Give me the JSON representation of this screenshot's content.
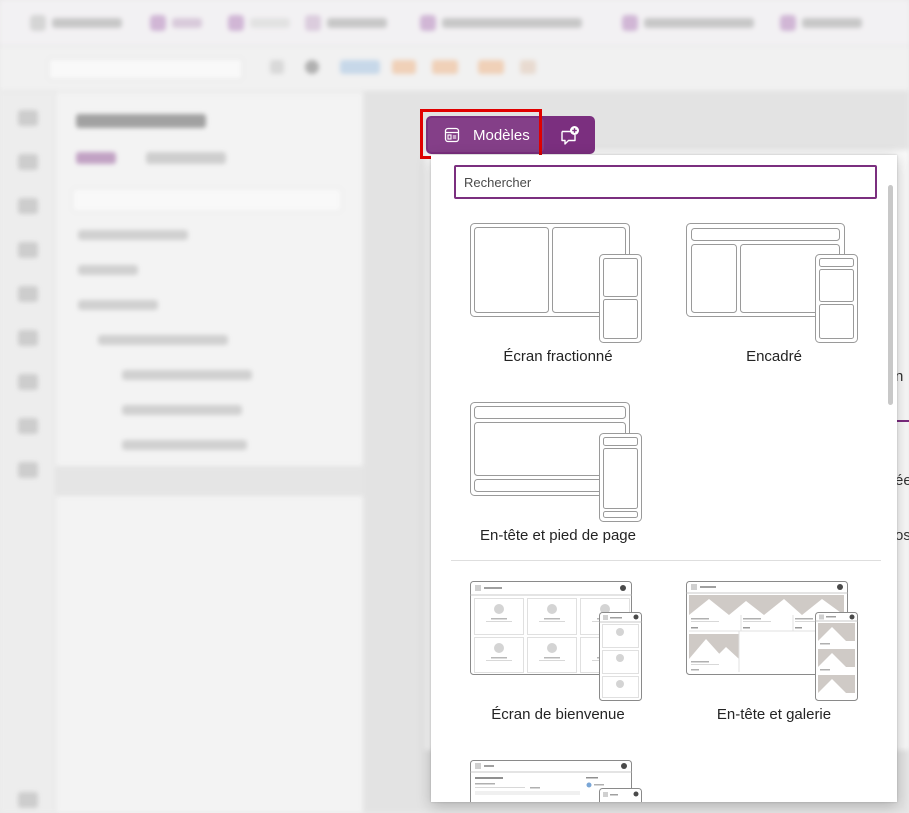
{
  "toolbar": {
    "templates_label": "Modèles",
    "templates_icon": "template-layout-icon",
    "comment_icon": "add-comment-icon"
  },
  "panel": {
    "search_placeholder": "Rechercher",
    "templates": [
      {
        "label": "Écran fractionné",
        "icon": "split-screen-layout"
      },
      {
        "label": "Encadré",
        "icon": "sidebar-layout"
      },
      {
        "label": "En-tête et pied de page",
        "icon": "header-footer-layout"
      },
      {
        "label": "Écran de bienvenue",
        "icon": "welcome-screen-thumbnail"
      },
      {
        "label": "En-tête et galerie",
        "icon": "header-gallery-thumbnail"
      }
    ]
  },
  "background": {
    "canvas_fragments": [
      "n",
      "ée",
      "os"
    ]
  },
  "colors": {
    "accent": "#7b2f7f",
    "button": "#843f88",
    "highlight": "#e00000",
    "outline": "#9a9a9a"
  }
}
